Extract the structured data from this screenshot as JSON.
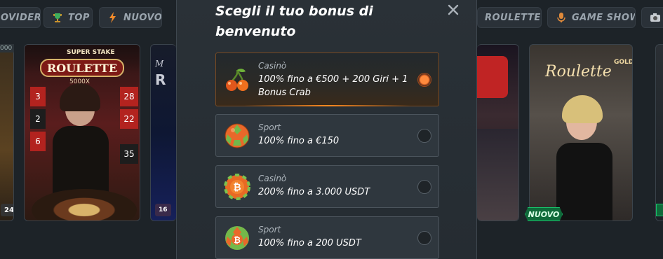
{
  "tabs": [
    {
      "label": "OVIDER",
      "icon": "provider-icon"
    },
    {
      "label": "TOP",
      "icon": "trophy-icon"
    },
    {
      "label": "NUOVO",
      "icon": "lightning-icon"
    },
    {
      "label": "ROULETTE",
      "icon": "roulette-icon"
    },
    {
      "label": "GAME SHOW",
      "icon": "microphone-icon"
    },
    {
      "label": "",
      "icon": "camera-icon"
    }
  ],
  "games": [
    {
      "name": "Super Stake Roulette",
      "logo_top": "SUPER STAKE",
      "logo_main": "ROULETTE",
      "logo_sub": "5000X",
      "tag": "24"
    },
    {
      "name": "Gold Roulette",
      "logo_top": "GOLD",
      "logo_main": "Roulette",
      "badge": "NUOVO"
    }
  ],
  "left_edge_tag": "24",
  "mid_tag": "16",
  "top_left_tag": "000",
  "modal": {
    "title": "Scegli il tuo bonus di benvenuto",
    "close_label": "×",
    "options": [
      {
        "category": "Casinò",
        "description": "100% fino a €500 + 200 Giri + 1 Bonus Crab",
        "icon": "cherries-icon",
        "selected": true
      },
      {
        "category": "Sport",
        "description": "100% fino a €150",
        "icon": "soccer-ball-icon",
        "selected": false
      },
      {
        "category": "Casinò",
        "description": "200% fino a 3.000 USDT",
        "icon": "bitcoin-chip-icon",
        "selected": false
      },
      {
        "category": "Sport",
        "description": "100% fino a 200 USDT",
        "icon": "bitcoin-ball-icon",
        "selected": false
      }
    ]
  },
  "colors": {
    "accent": "#ff8a20",
    "badge_green": "#18c06a"
  }
}
